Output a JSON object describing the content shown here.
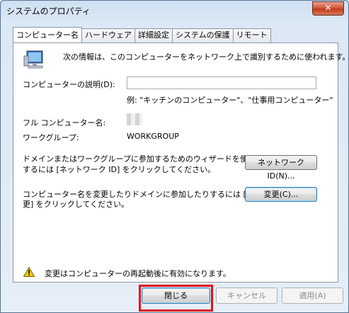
{
  "window": {
    "title": "システムのプロパティ",
    "close_glyph": "✕"
  },
  "tabs": [
    {
      "label": "コンピューター名",
      "active": true
    },
    {
      "label": "ハードウェア",
      "active": false
    },
    {
      "label": "詳細設定",
      "active": false
    },
    {
      "label": "システムの保護",
      "active": false
    },
    {
      "label": "リモート",
      "active": false
    }
  ],
  "panel": {
    "intro_text": "次の情報は、このコンピューターをネットワーク上で識別するために使われます。",
    "description_label": "コンピューターの説明(D):",
    "description_value": "",
    "description_hint": "例: \"キッチンのコンピューター\"、\"仕事用コンピューター\"",
    "full_name_label": "フル コンピューター名:",
    "full_name_value": "",
    "workgroup_label": "ワークグループ:",
    "workgroup_value": "WORKGROUP",
    "wizard_text_line1": "ドメインまたはワークグループに参加するためのウィザードを使用",
    "wizard_text_line2": "するには [ネットワーク ID] をクリックしてください。",
    "network_id_button": "ネットワーク ID(N)...",
    "rename_text_line1": "コンピューター名を変更したりドメインに参加したりするには [変",
    "rename_text_line2": "更] をクリックしてください。",
    "change_button": "変更(C)...",
    "warning_text": "変更はコンピューターの再起動後に有効になります。"
  },
  "footer": {
    "close_button": "閉じる",
    "cancel_button": "キャンセル",
    "apply_button": "適用(A)"
  },
  "colors": {
    "highlight": "#e0101a",
    "accent": "#3c7fb1"
  }
}
